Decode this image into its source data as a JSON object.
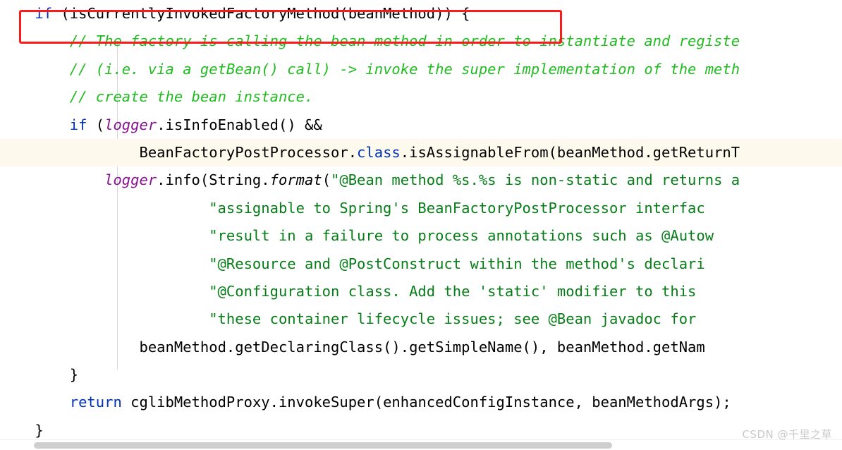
{
  "editor": {
    "language": "java",
    "theme": "IntelliJ Light",
    "colors": {
      "background": "#ffffff",
      "foreground": "#000000",
      "keyword": "#0033b3",
      "comment": "#22bb22",
      "string": "#067d17",
      "field": "#871094",
      "highlight_line_bg": "#fdf9ec",
      "annotation_box": "#fc1b1b",
      "indent_guide": "#d8d8d8",
      "scrollbar_thumb": "#cfcfcf",
      "watermark": "#c9c9c9"
    },
    "lines": [
      {
        "id": "line-1",
        "indent": "    ",
        "highlight": false,
        "tokens": [
          {
            "t": "if",
            "c": "kw"
          },
          {
            "t": " (isCurrentlyInvokedFactoryMethod(beanMethod)) {",
            "c": "plain"
          }
        ]
      },
      {
        "id": "line-2",
        "indent": "        ",
        "highlight": false,
        "tokens": [
          {
            "t": "// The factory is calling the bean method in order to instantiate and registe",
            "c": "cmt"
          }
        ]
      },
      {
        "id": "line-3",
        "indent": "        ",
        "highlight": false,
        "tokens": [
          {
            "t": "// (i.e. via a getBean() call) -> invoke the super implementation of the meth",
            "c": "cmt"
          }
        ]
      },
      {
        "id": "line-4",
        "indent": "        ",
        "highlight": false,
        "tokens": [
          {
            "t": "// create the bean instance.",
            "c": "cmt"
          }
        ]
      },
      {
        "id": "line-5",
        "indent": "        ",
        "highlight": false,
        "tokens": [
          {
            "t": "if",
            "c": "kw"
          },
          {
            "t": " (",
            "c": "plain"
          },
          {
            "t": "logger",
            "c": "fld"
          },
          {
            "t": ".isInfoEnabled() &&",
            "c": "plain"
          }
        ]
      },
      {
        "id": "line-6",
        "indent": "                ",
        "highlight": true,
        "tokens": [
          {
            "t": "BeanFactoryPostProcessor.",
            "c": "plain"
          },
          {
            "t": "class",
            "c": "kw"
          },
          {
            "t": ".isAssignableFrom(beanMethod.getReturnT",
            "c": "plain"
          }
        ]
      },
      {
        "id": "line-7",
        "indent": "            ",
        "highlight": false,
        "tokens": [
          {
            "t": "logger",
            "c": "fld"
          },
          {
            "t": ".info(String.",
            "c": "plain"
          },
          {
            "t": "format",
            "c": "stat"
          },
          {
            "t": "(",
            "c": "plain"
          },
          {
            "t": "\"@Bean method %s.%s is non-static and returns a",
            "c": "str"
          }
        ]
      },
      {
        "id": "line-8",
        "indent": "                        ",
        "highlight": false,
        "tokens": [
          {
            "t": "\"assignable to Spring's BeanFactoryPostProcessor interfac",
            "c": "str"
          }
        ]
      },
      {
        "id": "line-9",
        "indent": "                        ",
        "highlight": false,
        "tokens": [
          {
            "t": "\"result in a failure to process annotations such as @Autow",
            "c": "str"
          }
        ]
      },
      {
        "id": "line-10",
        "indent": "                        ",
        "highlight": false,
        "tokens": [
          {
            "t": "\"@Resource and @PostConstruct within the method's declari",
            "c": "str"
          }
        ]
      },
      {
        "id": "line-11",
        "indent": "                        ",
        "highlight": false,
        "tokens": [
          {
            "t": "\"@Configuration class. Add the 'static' modifier to this ",
            "c": "str"
          }
        ]
      },
      {
        "id": "line-12",
        "indent": "                        ",
        "highlight": false,
        "tokens": [
          {
            "t": "\"these container lifecycle issues; see @Bean javadoc for ",
            "c": "str"
          }
        ]
      },
      {
        "id": "line-13",
        "indent": "                ",
        "highlight": false,
        "tokens": [
          {
            "t": "beanMethod.getDeclaringClass().getSimpleName(), beanMethod.getNam",
            "c": "plain"
          }
        ]
      },
      {
        "id": "line-14",
        "indent": "        ",
        "highlight": false,
        "tokens": [
          {
            "t": "}",
            "c": "plain"
          }
        ]
      },
      {
        "id": "line-15",
        "indent": "        ",
        "highlight": false,
        "tokens": [
          {
            "t": "return",
            "c": "kw"
          },
          {
            "t": " cglibMethodProxy.invokeSuper(enhancedConfigInstance, beanMethodArgs);",
            "c": "plain"
          }
        ]
      },
      {
        "id": "line-16",
        "indent": "    ",
        "highlight": false,
        "tokens": [
          {
            "t": "}",
            "c": "plain"
          }
        ]
      }
    ]
  },
  "annotation": {
    "box_label": "red-highlight-rectangle",
    "target_line": "line-1"
  },
  "scrollbar": {
    "orientation": "horizontal",
    "label": "horizontal-scrollbar"
  },
  "watermark": {
    "text": "CSDN @千里之草"
  }
}
